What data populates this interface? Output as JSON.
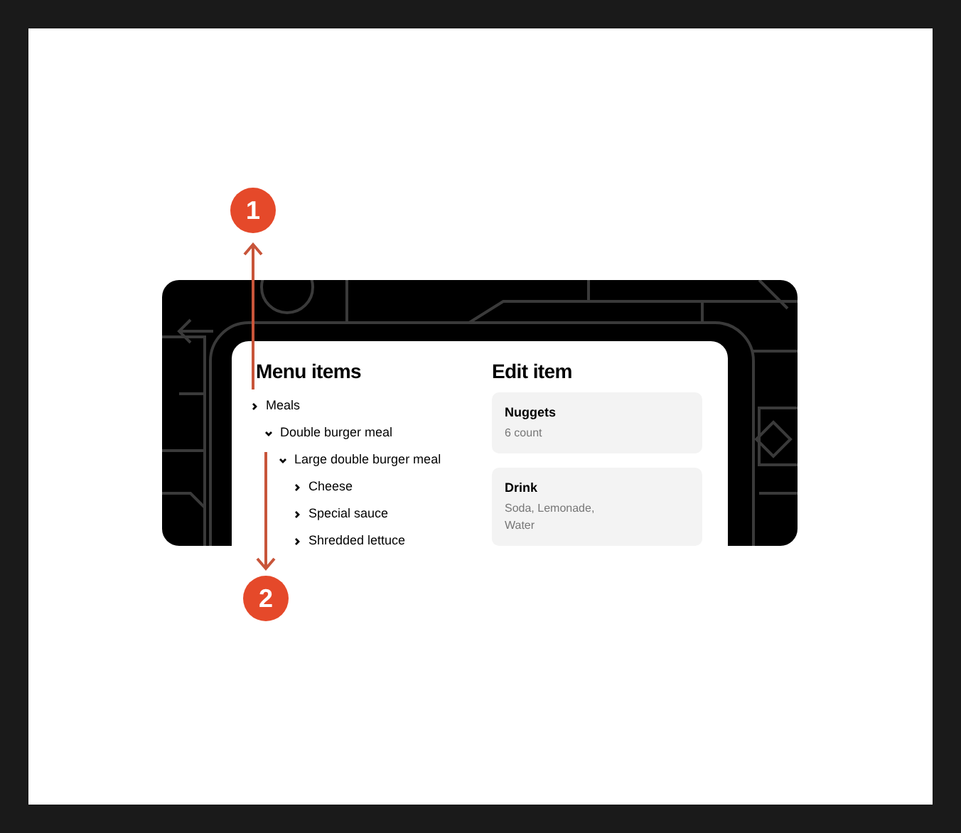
{
  "annotations": [
    {
      "label": "1"
    },
    {
      "label": "2"
    }
  ],
  "menu_items": {
    "title": "Menu items",
    "tree": [
      {
        "label": "Meals",
        "expanded": false,
        "children": [
          {
            "label": "Double burger meal",
            "expanded": true,
            "children": [
              {
                "label": "Large double burger meal",
                "expanded": true,
                "children": [
                  {
                    "label": "Cheese",
                    "expanded": false
                  },
                  {
                    "label": "Special sauce",
                    "expanded": false
                  },
                  {
                    "label": "Shredded lettuce",
                    "expanded": false
                  }
                ]
              }
            ]
          }
        ]
      }
    ]
  },
  "edit_item": {
    "title": "Edit item",
    "cards": [
      {
        "name": "Nuggets",
        "detail": "6 count"
      },
      {
        "name": "Drink",
        "detail": "Soda, Lemonade, Water"
      }
    ]
  }
}
